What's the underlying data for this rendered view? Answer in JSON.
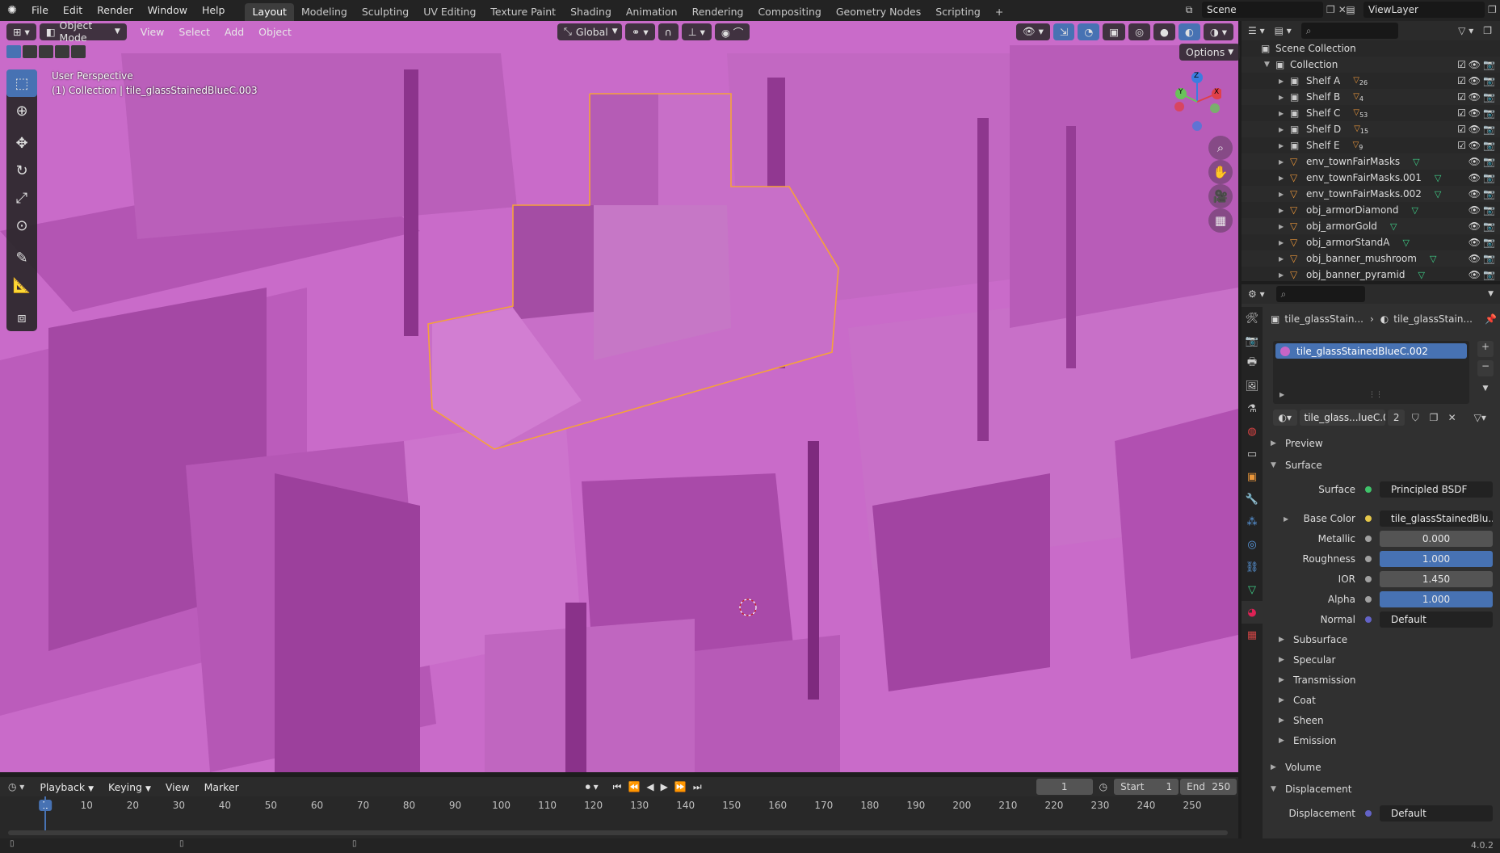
{
  "menubar": {
    "menus": [
      "File",
      "Edit",
      "Render",
      "Window",
      "Help"
    ],
    "workspaces": [
      "Layout",
      "Modeling",
      "Sculpting",
      "UV Editing",
      "Texture Paint",
      "Shading",
      "Animation",
      "Rendering",
      "Compositing",
      "Geometry Nodes",
      "Scripting"
    ],
    "active_workspace": "Layout",
    "add_tab": "+",
    "scene": "Scene",
    "view_layer": "ViewLayer"
  },
  "viewport": {
    "mode": "Object Mode",
    "menus": [
      "View",
      "Select",
      "Add",
      "Object"
    ],
    "transform_orientation": "Global",
    "options": "Options",
    "overlay_line1": "User Perspective",
    "overlay_line2": "(1) Collection | tile_glassStainedBlueC.003",
    "background_color": "#c665c6",
    "selection_color": "#f5a23a",
    "gizmo_axes": [
      "Z",
      "Y",
      "X"
    ]
  },
  "outliner": {
    "scene_collection": "Scene Collection",
    "collection": "Collection",
    "items": [
      {
        "name": "Shelf A",
        "badge": "26"
      },
      {
        "name": "Shelf B",
        "badge": "4"
      },
      {
        "name": "Shelf C",
        "badge": "53"
      },
      {
        "name": "Shelf D",
        "badge": "15"
      },
      {
        "name": "Shelf E",
        "badge": "9"
      },
      {
        "name": "env_townFairMasks",
        "badge": ""
      },
      {
        "name": "env_townFairMasks.001",
        "badge": ""
      },
      {
        "name": "env_townFairMasks.002",
        "badge": ""
      },
      {
        "name": "obj_armorDiamond",
        "badge": ""
      },
      {
        "name": "obj_armorGold",
        "badge": ""
      },
      {
        "name": "obj_armorStandA",
        "badge": ""
      },
      {
        "name": "obj_banner_mushroom",
        "badge": ""
      },
      {
        "name": "obj_banner_pyramid",
        "badge": ""
      }
    ]
  },
  "properties": {
    "breadcrumb_object": "tile_glassStain...",
    "breadcrumb_material": "tile_glassStain...",
    "material_slot": "tile_glassStainedBlueC.002",
    "material_name": "tile_glass...lueC.002",
    "user_count": "2",
    "sections": {
      "preview": "Preview",
      "surface": "Surface",
      "subsurface": "Subsurface",
      "specular": "Specular",
      "transmission": "Transmission",
      "coat": "Coat",
      "sheen": "Sheen",
      "emission": "Emission",
      "volume": "Volume",
      "displacement": "Displacement"
    },
    "fields": {
      "surface_label": "Surface",
      "surface_value": "Principled BSDF",
      "base_color_label": "Base Color",
      "base_color_value": "tile_glassStainedBlu...",
      "metallic_label": "Metallic",
      "metallic_value": "0.000",
      "roughness_label": "Roughness",
      "roughness_value": "1.000",
      "ior_label": "IOR",
      "ior_value": "1.450",
      "alpha_label": "Alpha",
      "alpha_value": "1.000",
      "normal_label": "Normal",
      "normal_value": "Default",
      "displacement_label": "Displacement",
      "displacement_value": "Default"
    }
  },
  "timeline": {
    "menus": [
      "Playback",
      "Keying",
      "View",
      "Marker"
    ],
    "current_frame": "1",
    "start_label": "Start",
    "start_value": "1",
    "end_label": "End",
    "end_value": "250",
    "ticks": [
      "1",
      "10",
      "20",
      "30",
      "40",
      "50",
      "60",
      "70",
      "80",
      "90",
      "100",
      "110",
      "120",
      "130",
      "140",
      "150",
      "160",
      "170",
      "180",
      "190",
      "200",
      "210",
      "220",
      "230",
      "240",
      "250"
    ]
  },
  "statusbar": {
    "version": "4.0.2"
  }
}
